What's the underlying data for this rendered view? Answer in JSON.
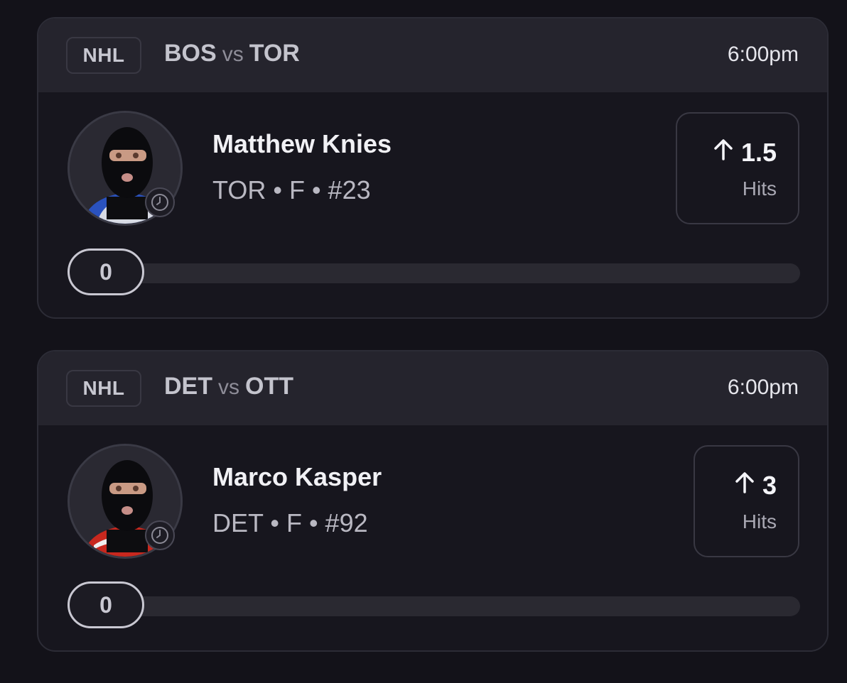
{
  "cards": [
    {
      "league": "NHL",
      "home_team": "BOS",
      "vs": "vs",
      "away_team": "TOR",
      "time": "6:00pm",
      "player_name": "Matthew Knies",
      "player_meta": "TOR • F • #23",
      "line_value": "1.5",
      "line_stat": "Hits",
      "progress_value": "0",
      "jersey_color": "#2a52be"
    },
    {
      "league": "NHL",
      "home_team": "DET",
      "vs": "vs",
      "away_team": "OTT",
      "time": "6:00pm",
      "player_name": "Marco Kasper",
      "player_meta": "DET • F • #92",
      "line_value": "3",
      "line_stat": "Hits",
      "progress_value": "0",
      "jersey_color": "#c8281e"
    }
  ],
  "icons": {
    "direction": "arrow-up-icon",
    "status": "clock-icon"
  }
}
